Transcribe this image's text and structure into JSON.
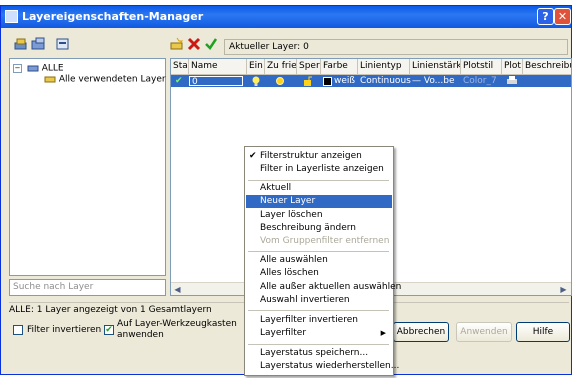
{
  "window": {
    "title": "Layereigenschaften-Manager",
    "help_glyph": "?",
    "close_glyph": "✕"
  },
  "toolbar": {
    "current_layer_label": "Aktueller Layer: 0"
  },
  "tree": {
    "root_label": "ALLE",
    "child_label": "Alle verwendeten Layer"
  },
  "search": {
    "placeholder": "Suche nach Layer"
  },
  "grid": {
    "headers": [
      "Stat",
      "Name",
      "Ein",
      "Zu frier",
      "Sper",
      "Farbe",
      "Linientyp",
      "Linienstärke",
      "Plotstil",
      "Plot",
      "Beschreibung"
    ],
    "row": {
      "name": "0",
      "color": "weiß",
      "linetype": "Continuous",
      "lineweight": "— Vo...be",
      "plotstyle": "Color_7"
    }
  },
  "status": {
    "text": "ALLE: 1 Layer angezeigt von 1 Gesamtlayern"
  },
  "options": {
    "invert_filter": "Filter invertieren",
    "apply_toolbar_line1": "Auf Layer-Werkzeugkasten",
    "apply_toolbar_line2": "anwenden"
  },
  "buttons": {
    "cancel": "Abbrechen",
    "apply": "Anwenden",
    "help": "Hilfe"
  },
  "context_menu": {
    "items": [
      "Filterstruktur anzeigen",
      "Filter in Layerliste anzeigen",
      "Aktuell",
      "Neuer Layer",
      "Layer löschen",
      "Beschreibung ändern",
      "Vom Gruppenfilter entfernen",
      "Alle auswählen",
      "Alles löschen",
      "Alle außer aktuellen auswählen",
      "Auswahl invertieren",
      "Layerfilter invertieren",
      "Layerfilter",
      "Layerstatus speichern...",
      "Layerstatus wiederherstellen..."
    ],
    "selected_item": "Neuer Layer"
  },
  "colors": {
    "title_bar": "#0a5ae8",
    "selection": "#316ac5",
    "dialog_bg": "#ece9d8"
  }
}
